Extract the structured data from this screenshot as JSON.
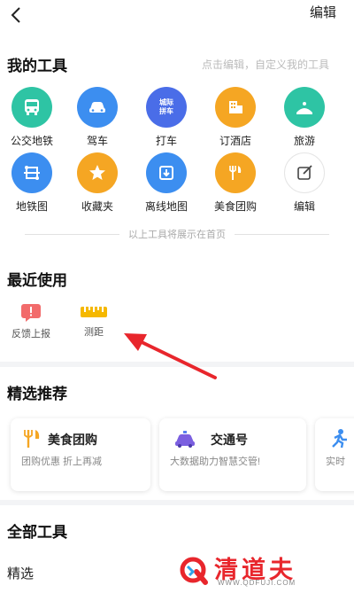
{
  "header": {
    "edit_label": "编辑"
  },
  "my_tools": {
    "title": "我的工具",
    "hint": "点击编辑，自定义我的工具",
    "items": [
      {
        "label": "公交地铁",
        "icon": "bus-icon",
        "color": "#2ec4a4"
      },
      {
        "label": "驾车",
        "icon": "car-icon",
        "color": "#3c8ef0"
      },
      {
        "label": "打车",
        "icon": "taxi-icon",
        "color": "#4a6de8"
      },
      {
        "label": "订酒店",
        "icon": "hotel-icon",
        "color": "#f5a623"
      },
      {
        "label": "旅游",
        "icon": "travel-icon",
        "color": "#2ec4a4"
      },
      {
        "label": "地铁图",
        "icon": "subway-map-icon",
        "color": "#3c8ef0"
      },
      {
        "label": "收藏夹",
        "icon": "star-icon",
        "color": "#f5a623"
      },
      {
        "label": "离线地图",
        "icon": "offline-map-icon",
        "color": "#3c8ef0"
      },
      {
        "label": "美食团购",
        "icon": "food-icon",
        "color": "#f5a623"
      },
      {
        "label": "编辑",
        "icon": "edit-icon",
        "color": "#ffffff"
      }
    ],
    "taxi_badge_line1": "城际",
    "taxi_badge_line2": "拼车"
  },
  "divider_text": "以上工具将展示在首页",
  "recent": {
    "title": "最近使用",
    "items": [
      {
        "label": "反馈上报",
        "icon": "feedback-icon",
        "color": "#f26b6b"
      },
      {
        "label": "测距",
        "icon": "ruler-icon",
        "color": "#f5b800"
      }
    ]
  },
  "featured": {
    "title": "精选推荐",
    "cards": [
      {
        "title": "美食团购",
        "subtitle": "团购优惠 折上再减",
        "icon": "food-icon"
      },
      {
        "title": "交通号",
        "subtitle": "大数据助力智慧交管!",
        "icon": "police-car-icon"
      },
      {
        "title": "",
        "subtitle": "实时",
        "icon": "runner-icon"
      }
    ]
  },
  "all_tools": {
    "title": "全部工具",
    "subtitle": "精选"
  },
  "watermark": {
    "text": "清道夫",
    "url": "WWW.QDFUJI.COM"
  }
}
